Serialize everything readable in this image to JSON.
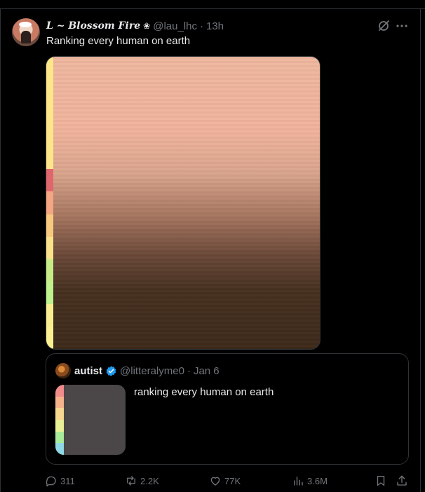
{
  "author": {
    "display_name": "L ~ Blossom Fire",
    "name_emoji": "❀",
    "handle": "@lau_lhc",
    "separator": "·",
    "time": "13h"
  },
  "tweet": {
    "text": "Ranking every human on earth"
  },
  "media": {
    "tier_colors": [
      "#fde68a",
      "#fde68a",
      "#fde68a",
      "#fde68a",
      "#fde68a",
      "#e0666d",
      "#f4a582",
      "#f7c97f",
      "#f9e28a",
      "#c6ec88",
      "#bff18c",
      "#f9ee8f",
      "#fbf192"
    ]
  },
  "quote": {
    "display_name": "autist",
    "handle": "@litteralyme0",
    "separator": "·",
    "time": "Jan 6",
    "text": "ranking every human on earth",
    "tier_colors": [
      "#f08c8c",
      "#f6b38a",
      "#f7d78f",
      "#e9f095",
      "#a8ec99",
      "#8fd9e6"
    ]
  },
  "actions": {
    "replies": "311",
    "reposts": "2.2K",
    "likes": "77K",
    "views": "3.6M"
  },
  "colors": {
    "background": "#000000",
    "text": "#e7e9ea",
    "muted": "#71767b",
    "border": "#2f3336",
    "verified": "#1d9bf0"
  }
}
